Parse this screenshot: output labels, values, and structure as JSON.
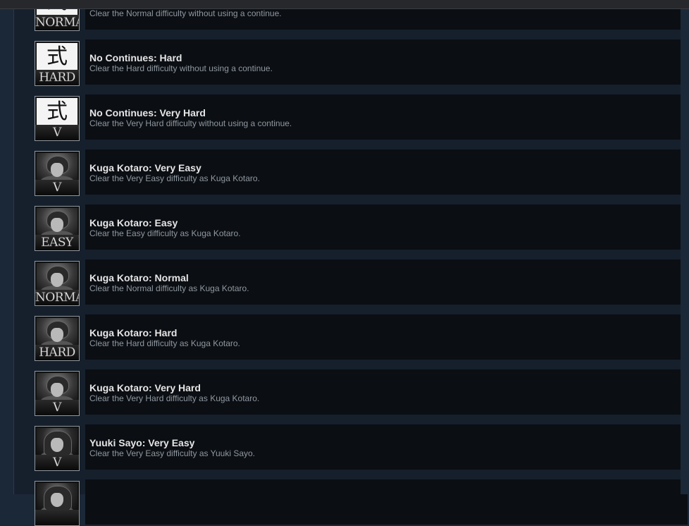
{
  "achievements": [
    {
      "title": "",
      "description": "Clear the Normal difficulty without using a continue.",
      "icon": "kanji-icon",
      "badge": "NORMAL"
    },
    {
      "title": "No Continues: Hard",
      "description": "Clear the Hard difficulty without using a continue.",
      "icon": "kanji-icon",
      "badge": "HARD"
    },
    {
      "title": "No Continues: Very Hard",
      "description": "Clear the Very Hard difficulty without using a continue.",
      "icon": "kanji-icon",
      "badge": "V HARD"
    },
    {
      "title": "Kuga Kotaro: Very Easy",
      "description": "Clear the Very Easy difficulty as Kuga Kotaro.",
      "icon": "kotaro-portrait-icon",
      "badge": "V EASY"
    },
    {
      "title": "Kuga Kotaro: Easy",
      "description": "Clear the Easy difficulty as Kuga Kotaro.",
      "icon": "kotaro-portrait-icon",
      "badge": "EASY"
    },
    {
      "title": "Kuga Kotaro: Normal",
      "description": "Clear the Normal difficulty as Kuga Kotaro.",
      "icon": "kotaro-portrait-icon",
      "badge": "NORMAL"
    },
    {
      "title": "Kuga Kotaro: Hard",
      "description": "Clear the Hard difficulty as Kuga Kotaro.",
      "icon": "kotaro-portrait-icon",
      "badge": "HARD"
    },
    {
      "title": "Kuga Kotaro: Very Hard",
      "description": "Clear the Very Hard difficulty as Kuga Kotaro.",
      "icon": "kotaro-portrait-icon",
      "badge": "V HARD"
    },
    {
      "title": "Yuuki Sayo: Very Easy",
      "description": "Clear the Very Easy difficulty as Yuuki Sayo.",
      "icon": "sayo-portrait-icon",
      "badge": "V EASY"
    },
    {
      "title": "",
      "description": "",
      "icon": "sayo-portrait-icon",
      "badge": ""
    }
  ],
  "kanji_glyph": "式",
  "colors": {
    "page_bg": "#1b2838",
    "card_bg": "#0b0e13",
    "title_text": "#e6e6e6",
    "desc_text": "#8f98a0"
  }
}
